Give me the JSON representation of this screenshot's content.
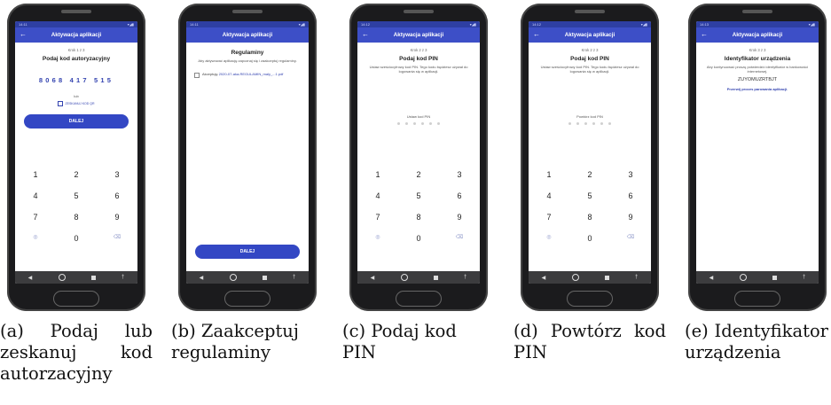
{
  "status_time": [
    "14:11",
    "14:11",
    "14:12",
    "14:12",
    "14:13"
  ],
  "app_title": "Aktywacja aplikacji",
  "back_arrow": "←",
  "nav_back": "◀",
  "nav_extra": "†",
  "keypad": [
    "1",
    "2",
    "3",
    "4",
    "5",
    "6",
    "7",
    "8",
    "9",
    "◎",
    "0",
    "⌫"
  ],
  "panel_a": {
    "step": "Krok 1 z 3",
    "heading": "Podaj kod autoryzacyjny",
    "code": "8068 417 515",
    "or": "lub",
    "scan": "ZESKANUJ KOD QR",
    "button": "DALEJ",
    "caption": "(a) Podaj lub zeskanuj kod autorzacyjny"
  },
  "panel_b": {
    "heading": "Regulaminy",
    "text": "Aby aktywować aplikację zapoznaj się i zaakceptuj regulaminy.",
    "checkbox_prefix": "Akceptuję",
    "checkbox_link": "2020-07-aka-REGULAMIN_maly_...1.pdf",
    "button": "DALEJ",
    "caption": "(b) Zaakceptuj regulaminy"
  },
  "panel_c": {
    "step": "Krok 2 z 3",
    "heading": "Podaj kod PIN",
    "text": "Ustaw sześciocyfrowy kod PIN. Tego kodu będziesz używał do logowania się w aplikacji.",
    "pin_label": "Ustaw kod PIN",
    "caption": "(c) Podaj kod PIN"
  },
  "panel_d": {
    "step": "Krok 2 z 3",
    "heading": "Podaj kod PIN",
    "text": "Ustaw sześciocyfrowy kod PIN. Tego kodu będziesz używał do logowania się w aplikacji.",
    "pin_label": "Powtórz kod PIN",
    "caption": "(d) Powtórz kod PIN"
  },
  "panel_e": {
    "step": "Krok 3 z 3",
    "heading": "Identyfikator urządzenia",
    "text": "Aby kontynuować proszę potwierdzić identyfikator w bankowości internetowej.",
    "device_id": "ZUYOMUZRTBJT",
    "link": "Przerwij proces parowania aplikacji.",
    "caption": "(e) Identyfikator urządzenia"
  }
}
